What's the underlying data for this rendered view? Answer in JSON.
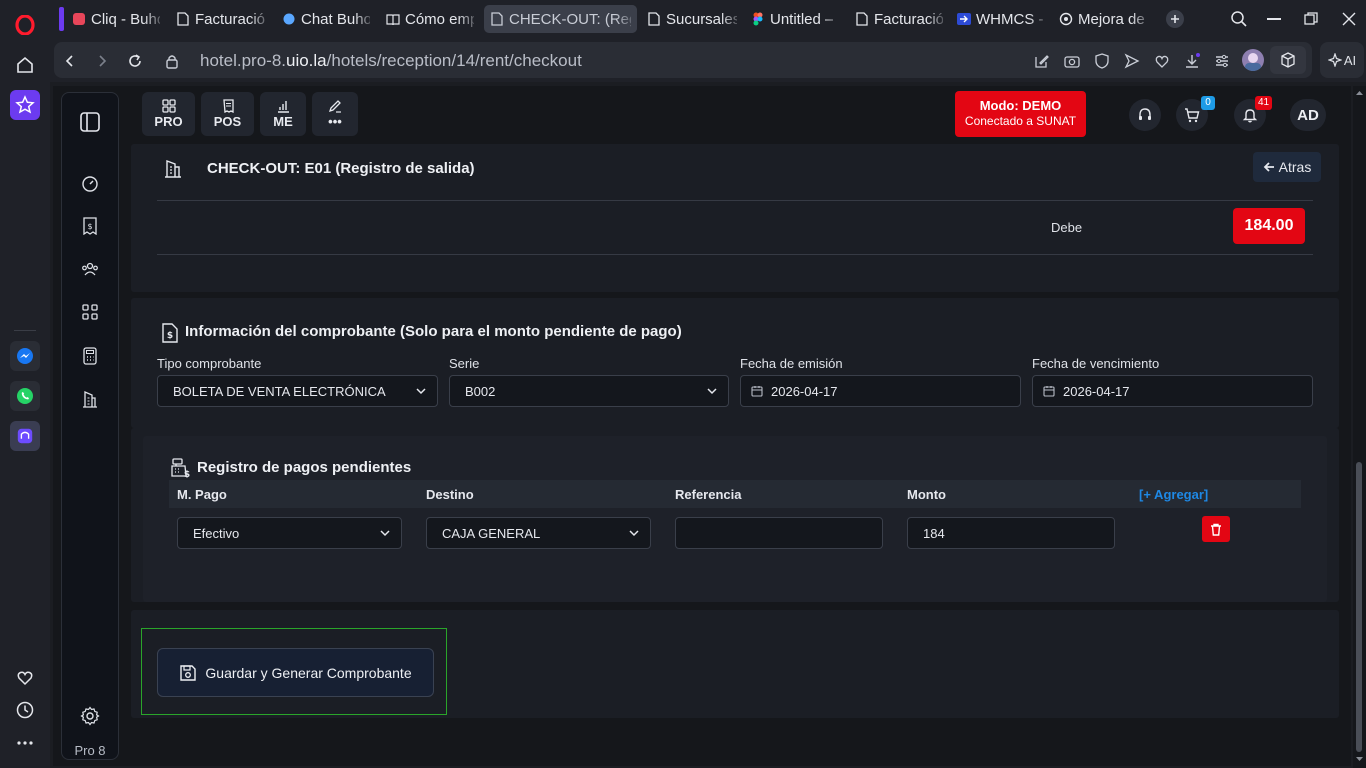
{
  "browser": {
    "tabs": [
      {
        "label": "Cliq - Buho",
        "icon": "chat-icon",
        "color": "#e8465a"
      },
      {
        "label": "Facturació",
        "icon": "document-icon",
        "color": "#e4e6eb"
      },
      {
        "label": "Chat Buho",
        "icon": "bubble-icon",
        "color": "#5aa7ff"
      },
      {
        "label": "Cómo emp",
        "icon": "book-icon",
        "color": "#e4e6eb"
      },
      {
        "label": "CHECK-OUT: (Reg",
        "icon": "document-icon",
        "color": "#e4e6eb"
      },
      {
        "label": "Sucursales",
        "icon": "document-icon",
        "color": "#e4e6eb"
      },
      {
        "label": "Untitled –",
        "icon": "figma-icon",
        "color": "#f24e1e"
      },
      {
        "label": "Facturació",
        "icon": "document-icon",
        "color": "#e4e6eb"
      },
      {
        "label": "WHMCS - T",
        "icon": "whmcs-icon",
        "color": "#2d4bd6"
      },
      {
        "label": "Mejora de",
        "icon": "openai-icon",
        "color": "#e4e6eb"
      }
    ],
    "url_prefix": "hotel.pro-8.",
    "url_domain": "uio.la",
    "url_path": "/hotels/reception/14/rent/checkout",
    "ai_label": "AI"
  },
  "app": {
    "top_tiles": [
      {
        "label": "PRO",
        "icon": "grid-icon"
      },
      {
        "label": "POS",
        "icon": "receipt-icon"
      },
      {
        "label": "ME",
        "icon": "chart-icon"
      },
      {
        "label": "•••",
        "icon": "edit-icon"
      }
    ],
    "mode_title": "Modo: DEMO",
    "mode_subtitle": "Conectado a SUNAT",
    "cart_count": "0",
    "notif_count": "41",
    "user_initials": "AD",
    "brand_label": "Pro 8",
    "colors": {
      "accent_red": "#e30613",
      "link_blue": "#1e88e5"
    }
  },
  "checkout": {
    "title": "CHECK-OUT: E01 (Registro de salida)",
    "back_label": "Atras",
    "owe_label": "Debe",
    "owe_value": "184.00"
  },
  "voucher": {
    "title": "Información del comprobante (Solo para el monto pendiente de pago)",
    "type_label": "Tipo comprobante",
    "type_value": "BOLETA DE VENTA ELECTRÓNICA",
    "series_label": "Serie",
    "series_value": "B002",
    "issue_label": "Fecha de emisión",
    "issue_value": "2026-04-17",
    "due_label": "Fecha de vencimiento",
    "due_value": "2026-04-17"
  },
  "payments": {
    "title": "Registro de pagos pendientes",
    "col_method": "M. Pago",
    "col_dest": "Destino",
    "col_ref": "Referencia",
    "col_amount": "Monto",
    "add_label": "[+ Agregar]",
    "row": {
      "method": "Efectivo",
      "dest": "CAJA GENERAL",
      "ref": "",
      "amount": "184"
    }
  },
  "actions": {
    "save_label": "Guardar y Generar Comprobante"
  }
}
